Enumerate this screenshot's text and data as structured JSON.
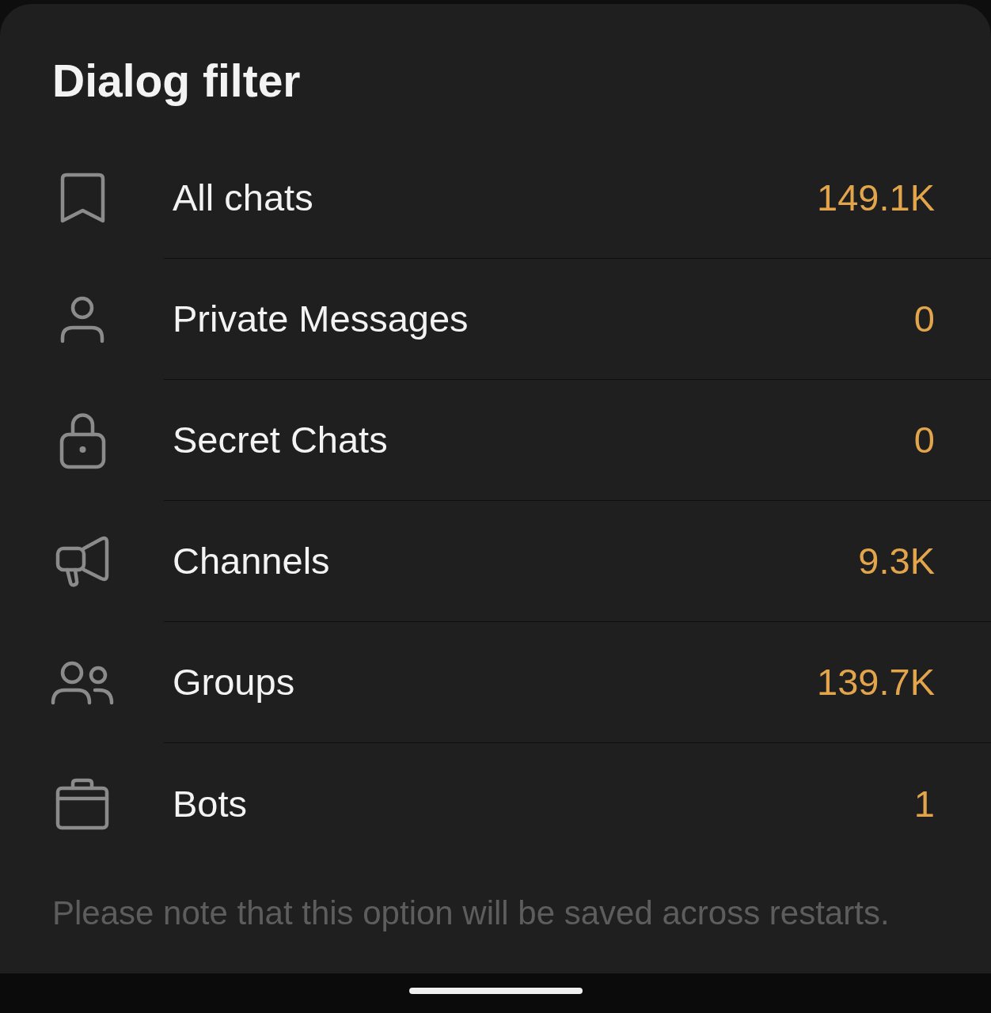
{
  "dialog": {
    "title": "Dialog filter",
    "options": [
      {
        "kind": "bookmark",
        "label": "All chats",
        "count": "149.1K"
      },
      {
        "kind": "person",
        "label": "Private Messages",
        "count": "0"
      },
      {
        "kind": "lock",
        "label": "Secret Chats",
        "count": "0"
      },
      {
        "kind": "megaphone",
        "label": "Channels",
        "count": "9.3K"
      },
      {
        "kind": "people",
        "label": "Groups",
        "count": "139.7K"
      },
      {
        "kind": "briefcase",
        "label": "Bots",
        "count": "1"
      }
    ],
    "note": "Please note that this option will be saved across restarts."
  }
}
